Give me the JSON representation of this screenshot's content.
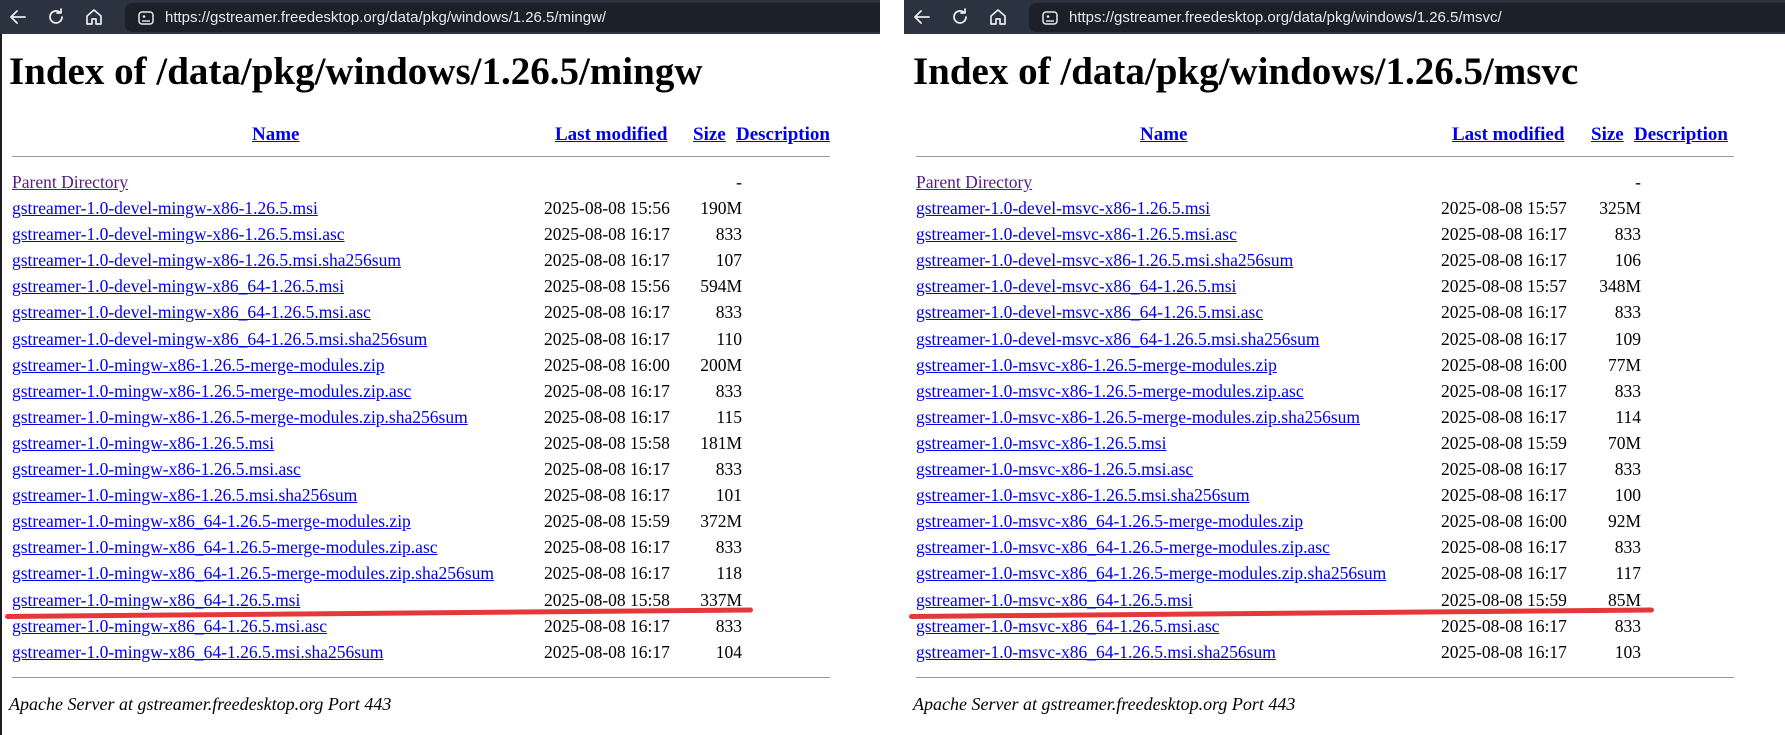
{
  "left": {
    "url": "https://gstreamer.freedesktop.org/data/pkg/windows/1.26.5/mingw/",
    "title": "Index of /data/pkg/windows/1.26.5/mingw",
    "headers": {
      "name": "Name",
      "modified": "Last modified",
      "size": "Size",
      "description": "Description"
    },
    "parent": {
      "name": "Parent Directory",
      "size": "-"
    },
    "rows": [
      {
        "name": "gstreamer-1.0-devel-mingw-x86-1.26.5.msi",
        "modified": "2025-08-08 15:56",
        "size": "190M"
      },
      {
        "name": "gstreamer-1.0-devel-mingw-x86-1.26.5.msi.asc",
        "modified": "2025-08-08 16:17",
        "size": "833"
      },
      {
        "name": "gstreamer-1.0-devel-mingw-x86-1.26.5.msi.sha256sum",
        "modified": "2025-08-08 16:17",
        "size": "107"
      },
      {
        "name": "gstreamer-1.0-devel-mingw-x86_64-1.26.5.msi",
        "modified": "2025-08-08 15:56",
        "size": "594M"
      },
      {
        "name": "gstreamer-1.0-devel-mingw-x86_64-1.26.5.msi.asc",
        "modified": "2025-08-08 16:17",
        "size": "833"
      },
      {
        "name": "gstreamer-1.0-devel-mingw-x86_64-1.26.5.msi.sha256sum",
        "modified": "2025-08-08 16:17",
        "size": "110"
      },
      {
        "name": "gstreamer-1.0-mingw-x86-1.26.5-merge-modules.zip",
        "modified": "2025-08-08 16:00",
        "size": "200M"
      },
      {
        "name": "gstreamer-1.0-mingw-x86-1.26.5-merge-modules.zip.asc",
        "modified": "2025-08-08 16:17",
        "size": "833"
      },
      {
        "name": "gstreamer-1.0-mingw-x86-1.26.5-merge-modules.zip.sha256sum",
        "modified": "2025-08-08 16:17",
        "size": "115"
      },
      {
        "name": "gstreamer-1.0-mingw-x86-1.26.5.msi",
        "modified": "2025-08-08 15:58",
        "size": "181M"
      },
      {
        "name": "gstreamer-1.0-mingw-x86-1.26.5.msi.asc",
        "modified": "2025-08-08 16:17",
        "size": "833"
      },
      {
        "name": "gstreamer-1.0-mingw-x86-1.26.5.msi.sha256sum",
        "modified": "2025-08-08 16:17",
        "size": "101"
      },
      {
        "name": "gstreamer-1.0-mingw-x86_64-1.26.5-merge-modules.zip",
        "modified": "2025-08-08 15:59",
        "size": "372M"
      },
      {
        "name": "gstreamer-1.0-mingw-x86_64-1.26.5-merge-modules.zip.asc",
        "modified": "2025-08-08 16:17",
        "size": "833"
      },
      {
        "name": "gstreamer-1.0-mingw-x86_64-1.26.5-merge-modules.zip.sha256sum",
        "modified": "2025-08-08 16:17",
        "size": "118"
      },
      {
        "name": "gstreamer-1.0-mingw-x86_64-1.26.5.msi",
        "modified": "2025-08-08 15:58",
        "size": "337M"
      },
      {
        "name": "gstreamer-1.0-mingw-x86_64-1.26.5.msi.asc",
        "modified": "2025-08-08 16:17",
        "size": "833"
      },
      {
        "name": "gstreamer-1.0-mingw-x86_64-1.26.5.msi.sha256sum",
        "modified": "2025-08-08 16:17",
        "size": "104"
      }
    ],
    "footer": "Apache Server at gstreamer.freedesktop.org Port 443"
  },
  "right": {
    "url": "https://gstreamer.freedesktop.org/data/pkg/windows/1.26.5/msvc/",
    "title": "Index of /data/pkg/windows/1.26.5/msvc",
    "headers": {
      "name": "Name",
      "modified": "Last modified",
      "size": "Size",
      "description": "Description"
    },
    "parent": {
      "name": "Parent Directory",
      "size": "-"
    },
    "rows": [
      {
        "name": "gstreamer-1.0-devel-msvc-x86-1.26.5.msi",
        "modified": "2025-08-08 15:57",
        "size": "325M"
      },
      {
        "name": "gstreamer-1.0-devel-msvc-x86-1.26.5.msi.asc",
        "modified": "2025-08-08 16:17",
        "size": "833"
      },
      {
        "name": "gstreamer-1.0-devel-msvc-x86-1.26.5.msi.sha256sum",
        "modified": "2025-08-08 16:17",
        "size": "106"
      },
      {
        "name": "gstreamer-1.0-devel-msvc-x86_64-1.26.5.msi",
        "modified": "2025-08-08 15:57",
        "size": "348M"
      },
      {
        "name": "gstreamer-1.0-devel-msvc-x86_64-1.26.5.msi.asc",
        "modified": "2025-08-08 16:17",
        "size": "833"
      },
      {
        "name": "gstreamer-1.0-devel-msvc-x86_64-1.26.5.msi.sha256sum",
        "modified": "2025-08-08 16:17",
        "size": "109"
      },
      {
        "name": "gstreamer-1.0-msvc-x86-1.26.5-merge-modules.zip",
        "modified": "2025-08-08 16:00",
        "size": "77M"
      },
      {
        "name": "gstreamer-1.0-msvc-x86-1.26.5-merge-modules.zip.asc",
        "modified": "2025-08-08 16:17",
        "size": "833"
      },
      {
        "name": "gstreamer-1.0-msvc-x86-1.26.5-merge-modules.zip.sha256sum",
        "modified": "2025-08-08 16:17",
        "size": "114"
      },
      {
        "name": "gstreamer-1.0-msvc-x86-1.26.5.msi",
        "modified": "2025-08-08 15:59",
        "size": "70M"
      },
      {
        "name": "gstreamer-1.0-msvc-x86-1.26.5.msi.asc",
        "modified": "2025-08-08 16:17",
        "size": "833"
      },
      {
        "name": "gstreamer-1.0-msvc-x86-1.26.5.msi.sha256sum",
        "modified": "2025-08-08 16:17",
        "size": "100"
      },
      {
        "name": "gstreamer-1.0-msvc-x86_64-1.26.5-merge-modules.zip",
        "modified": "2025-08-08 16:00",
        "size": "92M"
      },
      {
        "name": "gstreamer-1.0-msvc-x86_64-1.26.5-merge-modules.zip.asc",
        "modified": "2025-08-08 16:17",
        "size": "833"
      },
      {
        "name": "gstreamer-1.0-msvc-x86_64-1.26.5-merge-modules.zip.sha256sum",
        "modified": "2025-08-08 16:17",
        "size": "117"
      },
      {
        "name": "gstreamer-1.0-msvc-x86_64-1.26.5.msi",
        "modified": "2025-08-08 15:59",
        "size": "85M"
      },
      {
        "name": "gstreamer-1.0-msvc-x86_64-1.26.5.msi.asc",
        "modified": "2025-08-08 16:17",
        "size": "833"
      },
      {
        "name": "gstreamer-1.0-msvc-x86_64-1.26.5.msi.sha256sum",
        "modified": "2025-08-08 16:17",
        "size": "103"
      }
    ],
    "footer": "Apache Server at gstreamer.freedesktop.org Port 443"
  },
  "colors": {
    "toolbar": "#2b3340",
    "link": "#0000ee",
    "visited": "#551a8b",
    "annotation": "#e5383b"
  },
  "icons": [
    "back-arrow-icon",
    "reload-icon",
    "home-icon",
    "site-info-icon"
  ],
  "annotation_row_index": 15
}
